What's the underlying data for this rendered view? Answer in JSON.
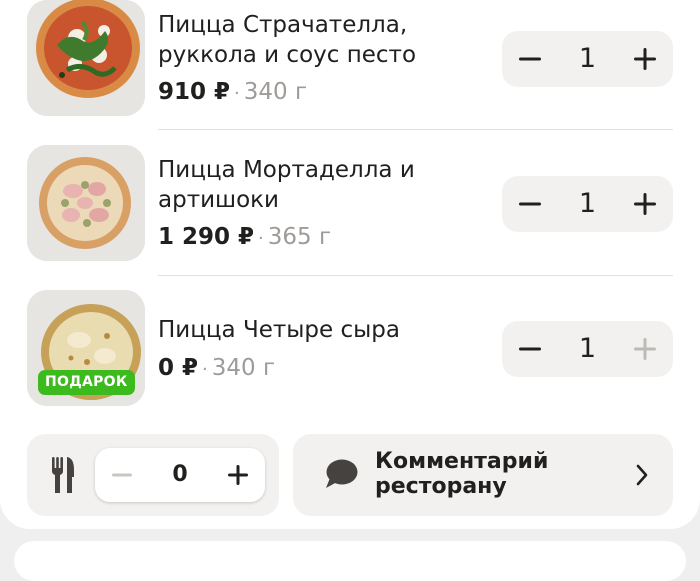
{
  "colors": {
    "accent_green": "#3cba1e",
    "text_primary": "#21201f",
    "text_secondary": "#9e9b98",
    "surface_muted": "#f2f1ef"
  },
  "cart": {
    "items": [
      {
        "name": "Пицца Страчателла, руккола и соус песто",
        "price": "910 ₽",
        "weight": "340 г",
        "quantity": "1",
        "plus_enabled": true
      },
      {
        "name": "Пицца Мортаделла и артишоки",
        "price": "1 290 ₽",
        "weight": "365 г",
        "quantity": "1",
        "plus_enabled": true
      },
      {
        "name": "Пицца Четыре сыра",
        "price": "0 ₽",
        "weight": "340 г",
        "quantity": "1",
        "plus_enabled": false,
        "badge": "ПОДАРОК"
      }
    ],
    "separator_dot": "·",
    "minus_symbol": "−",
    "plus_symbol": "+"
  },
  "cutlery": {
    "icon": "cutlery-icon",
    "quantity": "0",
    "minus_enabled": false
  },
  "comment": {
    "icon": "speech-bubble-icon",
    "label": "Комментарий ресторану"
  }
}
